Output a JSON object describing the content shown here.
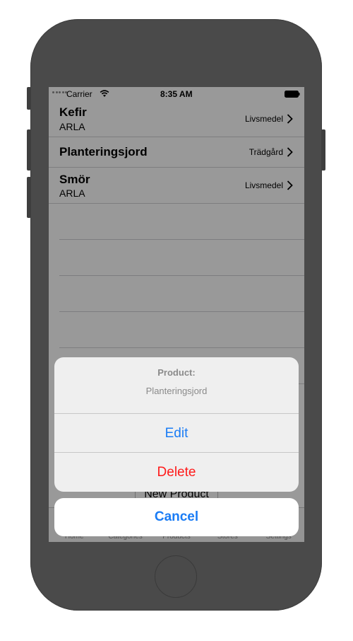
{
  "status_bar": {
    "carrier": "Carrier",
    "time": "8:35 AM"
  },
  "products": [
    {
      "name": "Kefir",
      "brand": "ARLA",
      "category": "Livsmedel"
    },
    {
      "name": "Planteringsjord",
      "brand": "",
      "category": "Trädgård"
    },
    {
      "name": "Smör",
      "brand": "ARLA",
      "category": "Livsmedel"
    }
  ],
  "new_product_button": "New Product",
  "tabs": [
    "Home",
    "Categories",
    "Products",
    "Stores",
    "Settings"
  ],
  "action_sheet": {
    "title": "Product:",
    "message": "Planteringsjord",
    "edit": "Edit",
    "delete": "Delete",
    "cancel": "Cancel"
  },
  "colors": {
    "accent": "#1a7cf5",
    "destructive": "#ff1a1a"
  }
}
